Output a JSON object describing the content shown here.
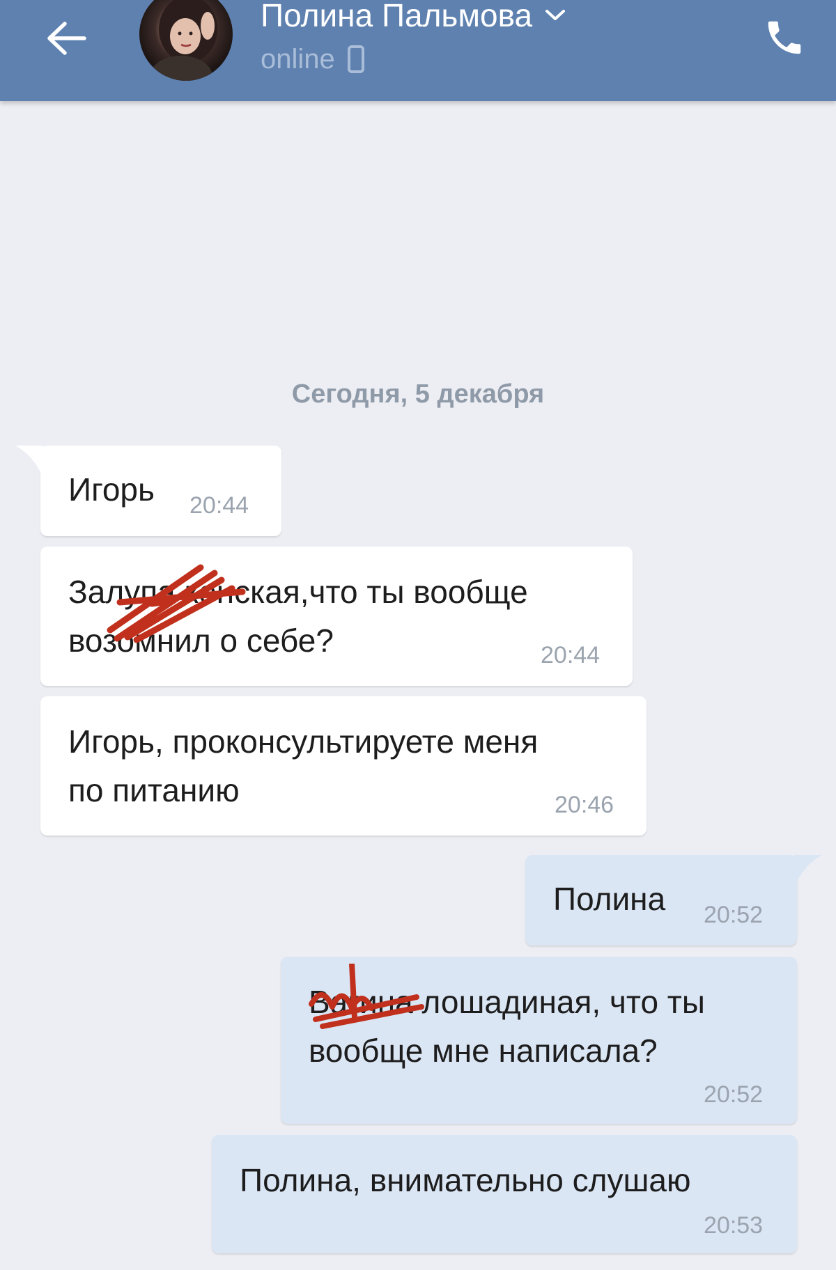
{
  "header": {
    "back_icon": "arrow-left-icon",
    "contact_name": "Полина Пальмова",
    "status": "online",
    "status_icon": "mobile-phone-icon",
    "call_icon": "phone-icon",
    "background": "#5e81b0"
  },
  "conversation": {
    "date_divider": "Сегодня, 5 декабря",
    "messages": [
      {
        "direction": "incoming",
        "lines": [
          "Игорь"
        ],
        "time": "20:44"
      },
      {
        "direction": "incoming",
        "lines": [
          "Залупа конская,что ты вообще",
          "возомнил о себе?"
        ],
        "time": "20:44",
        "redacted": true
      },
      {
        "direction": "incoming",
        "lines": [
          "Игорь, проконсультируете меня",
          "по питанию"
        ],
        "time": "20:46"
      },
      {
        "direction": "outgoing",
        "lines": [
          "Полина"
        ],
        "time": "20:52"
      },
      {
        "direction": "outgoing",
        "lines": [
          "Вагина лошадиная, что ты",
          "вообще мне написала?"
        ],
        "time": "20:52",
        "redacted": true
      },
      {
        "direction": "outgoing",
        "lines": [
          "Полина, внимательно слушаю"
        ],
        "time": "20:53"
      }
    ]
  },
  "colors": {
    "incoming_bubble": "#ffffff",
    "outgoing_bubble": "#dbe6f5",
    "background": "#edeef3",
    "redaction_scribble": "#c0301c"
  }
}
